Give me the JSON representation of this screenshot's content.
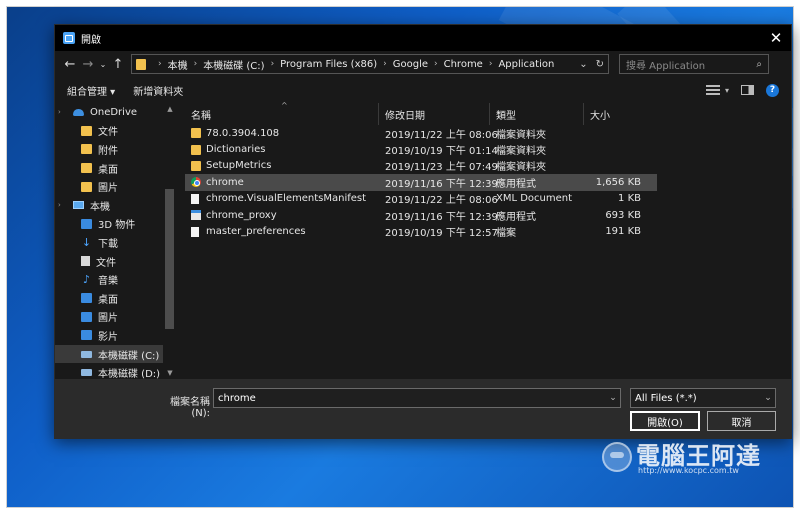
{
  "window": {
    "title": "開啟",
    "close_glyph": "✕"
  },
  "nav": {
    "back": "←",
    "forward": "→",
    "recent": "⌄",
    "up": "↑"
  },
  "address": {
    "crumbs": [
      "本機",
      "本機磁碟 (C:)",
      "Program Files (x86)",
      "Google",
      "Chrome",
      "Application"
    ],
    "separator": "›",
    "dropdown": "⌄",
    "refresh": "↻"
  },
  "search": {
    "placeholder": "搜尋 Application",
    "icon": "⌕"
  },
  "toolbar": {
    "organize": "組合管理 ▾",
    "new_folder": "新增資料夾",
    "view_dropdown": "▾",
    "help": "?"
  },
  "sidebar": {
    "items": [
      {
        "label": "OneDrive",
        "icon": "cloud",
        "level": "top"
      },
      {
        "label": "文件",
        "icon": "folder"
      },
      {
        "label": "附件",
        "icon": "folder"
      },
      {
        "label": "桌面",
        "icon": "folder"
      },
      {
        "label": "圖片",
        "icon": "folder"
      },
      {
        "label": "本機",
        "icon": "pc",
        "level": "top"
      },
      {
        "label": "3D 物件",
        "icon": "blue"
      },
      {
        "label": "下載",
        "icon": "arrow"
      },
      {
        "label": "文件",
        "icon": "doc"
      },
      {
        "label": "音樂",
        "icon": "note"
      },
      {
        "label": "桌面",
        "icon": "blue"
      },
      {
        "label": "圖片",
        "icon": "blue"
      },
      {
        "label": "影片",
        "icon": "blue"
      },
      {
        "label": "本機磁碟 (C:)",
        "icon": "drive",
        "selected": true
      },
      {
        "label": "本機磁碟 (D:)",
        "icon": "drive"
      }
    ]
  },
  "columns": {
    "name": "名稱",
    "date": "修改日期",
    "type": "類型",
    "size": "大小",
    "sort_caret": "^"
  },
  "files": [
    {
      "name": "78.0.3904.108",
      "date": "2019/11/22 上午 08:06",
      "type": "檔案資料夾",
      "size": "",
      "icon": "folder"
    },
    {
      "name": "Dictionaries",
      "date": "2019/10/19 下午 01:14",
      "type": "檔案資料夾",
      "size": "",
      "icon": "folder"
    },
    {
      "name": "SetupMetrics",
      "date": "2019/11/23 上午 07:49",
      "type": "檔案資料夾",
      "size": "",
      "icon": "folder"
    },
    {
      "name": "chrome",
      "date": "2019/11/16 下午 12:39",
      "type": "應用程式",
      "size": "1,656 KB",
      "icon": "chrome",
      "selected": true
    },
    {
      "name": "chrome.VisualElementsManifest",
      "date": "2019/11/22 上午 08:06",
      "type": "XML Document",
      "size": "1 KB",
      "icon": "doc"
    },
    {
      "name": "chrome_proxy",
      "date": "2019/11/16 下午 12:39",
      "type": "應用程式",
      "size": "693 KB",
      "icon": "exe"
    },
    {
      "name": "master_preferences",
      "date": "2019/10/19 下午 12:57",
      "type": "檔案",
      "size": "191 KB",
      "icon": "doc"
    }
  ],
  "bottom": {
    "filename_label": "檔案名稱(N):",
    "filename_value": "chrome",
    "filter_value": "All Files (*.*)",
    "dropdown": "⌄",
    "open_label": "開啟(O)",
    "cancel_label": "取消"
  },
  "watermark": {
    "text": "電腦王阿達",
    "url": "http://www.kocpc.com.tw"
  }
}
